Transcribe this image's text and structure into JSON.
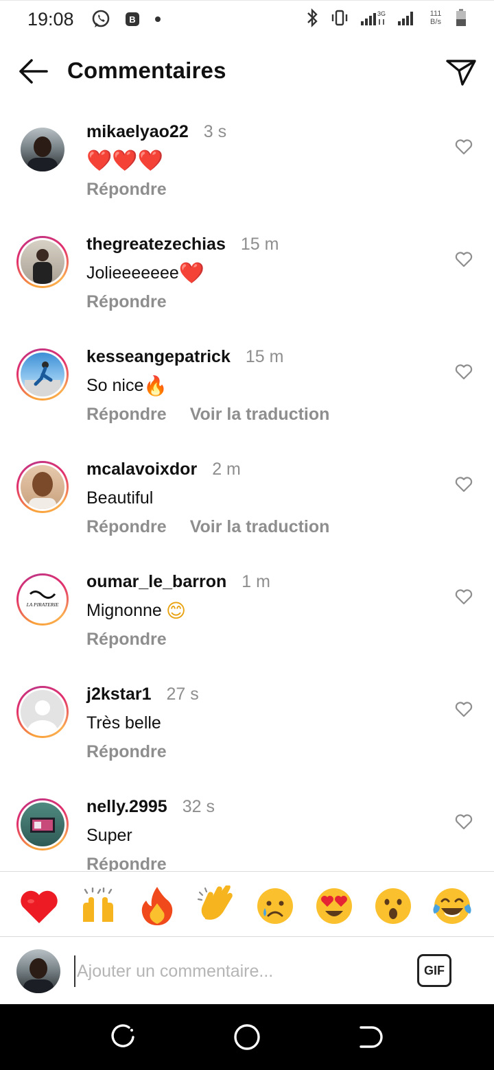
{
  "status_bar": {
    "time": "19:08",
    "net_speed_value": "111",
    "net_speed_unit": "B/s",
    "network_type": "3G"
  },
  "header": {
    "title": "Commentaires"
  },
  "actions": {
    "reply": "Répondre",
    "translate": "Voir la traduction"
  },
  "comments": [
    {
      "username": "mikaelyao22",
      "time": "3 s",
      "text": "",
      "emoji": "❤️❤️❤️"
    },
    {
      "username": "thegreatezechias",
      "time": "15 m",
      "text": "Jolieeeeeee",
      "emoji": "❤️"
    },
    {
      "username": "kesseangepatrick",
      "time": "15 m",
      "text": "So nice",
      "emoji": "🔥"
    },
    {
      "username": "mcalavoixdor",
      "time": "2 m",
      "text": "Beautiful",
      "emoji": ""
    },
    {
      "username": "oumar_le_barron",
      "time": "1 m",
      "text": "Mignonne ",
      "emoji": "😊",
      "avatar_text": "LA PIRATERIE"
    },
    {
      "username": "j2kstar1",
      "time": "27 s",
      "text": "Très belle",
      "emoji": ""
    },
    {
      "username": "nelly.2995",
      "time": "32 s",
      "text": "Super",
      "emoji": ""
    }
  ],
  "emoji_bar": [
    "❤️",
    "🙌",
    "🔥",
    "👏",
    "😢",
    "😍",
    "😮",
    "😂"
  ],
  "composer": {
    "placeholder": "Ajouter un commentaire...",
    "gif_label": "GIF"
  },
  "colors": {
    "text_primary": "#111111",
    "text_secondary": "#8e8e8e",
    "heart_red": "#ed1c24",
    "story_ring_start": "#f9a13a",
    "story_ring_end": "#c13584"
  }
}
